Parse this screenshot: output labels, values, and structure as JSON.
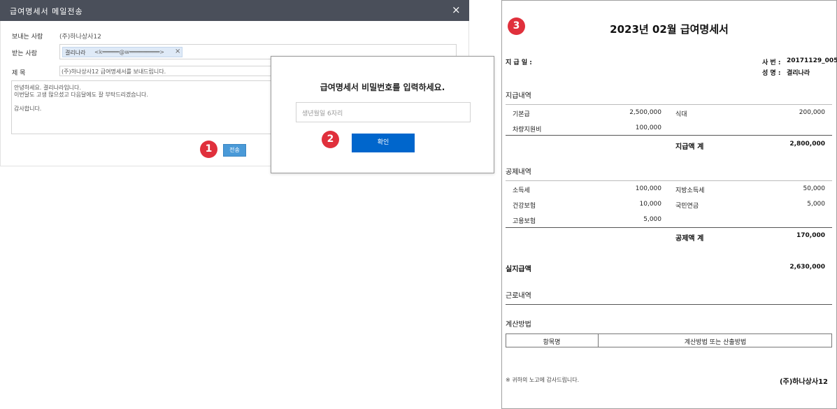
{
  "email_dialog": {
    "title": "급여명세서 메일전송",
    "close_icon": "×",
    "sender_label": "보내는 사람",
    "sender_value": "(주)하나상사12",
    "recipient_label": "받는 사람",
    "recipient_name": "결리나라",
    "recipient_email": "<k═════@w═════════>",
    "recipient_remove": "×",
    "subject_label": "제 목",
    "subject_value": "(주)하나상사12 급여명세서를 보내드립니다.",
    "body_lines": [
      "안녕하세요. 결리나라입니다.",
      "이번달도 고생 많으셨고 다음달에도 잘 부탁드리겠습니다.",
      "",
      "감사합니다."
    ],
    "send_label": "전송"
  },
  "steps": {
    "one": "1",
    "two": "2",
    "three": "3"
  },
  "password_dialog": {
    "prompt": "급여명세서 비밀번호를 입력하세요.",
    "placeholder": "생년월일 6자리",
    "confirm_label": "확인"
  },
  "payslip": {
    "title": "2023년 02월 급여명세서",
    "pay_date_label": "지 급 일 :",
    "employee_no_label": "사 번 :",
    "employee_no": "20171129_005",
    "name_label": "성 명 :",
    "name": "결리나라",
    "earnings_title": "지급내역",
    "earnings": [
      {
        "label": "기본급",
        "value": "2,500,000"
      },
      {
        "label": "식대",
        "value": "200,000"
      },
      {
        "label": "차량지원비",
        "value": "100,000"
      }
    ],
    "earnings_total_label": "지급액 계",
    "earnings_total": "2,800,000",
    "deductions_title": "공제내역",
    "deductions": [
      {
        "label": "소득세",
        "value": "100,000"
      },
      {
        "label": "지방소득세",
        "value": "50,000"
      },
      {
        "label": "건강보험",
        "value": "10,000"
      },
      {
        "label": "국민연금",
        "value": "5,000"
      },
      {
        "label": "고용보험",
        "value": "5,000"
      }
    ],
    "deductions_total_label": "공제액 계",
    "deductions_total": "170,000",
    "net_pay_label": "실지급액",
    "net_pay": "2,630,000",
    "work_title": "근로내역",
    "calc_title": "계산방법",
    "calc_headers": [
      "항목명",
      "계산방법 또는 산출방법"
    ],
    "footer_note": "※ 귀하의 노고에 감사드립니다.",
    "company": "(주)하나상사12"
  },
  "colors": {
    "titlebar": "#4a4f5a",
    "send_button": "#4a9ad8",
    "confirm_button": "#0066cc",
    "step_badge": "#e0303c",
    "chip": "#dfeaf7"
  }
}
